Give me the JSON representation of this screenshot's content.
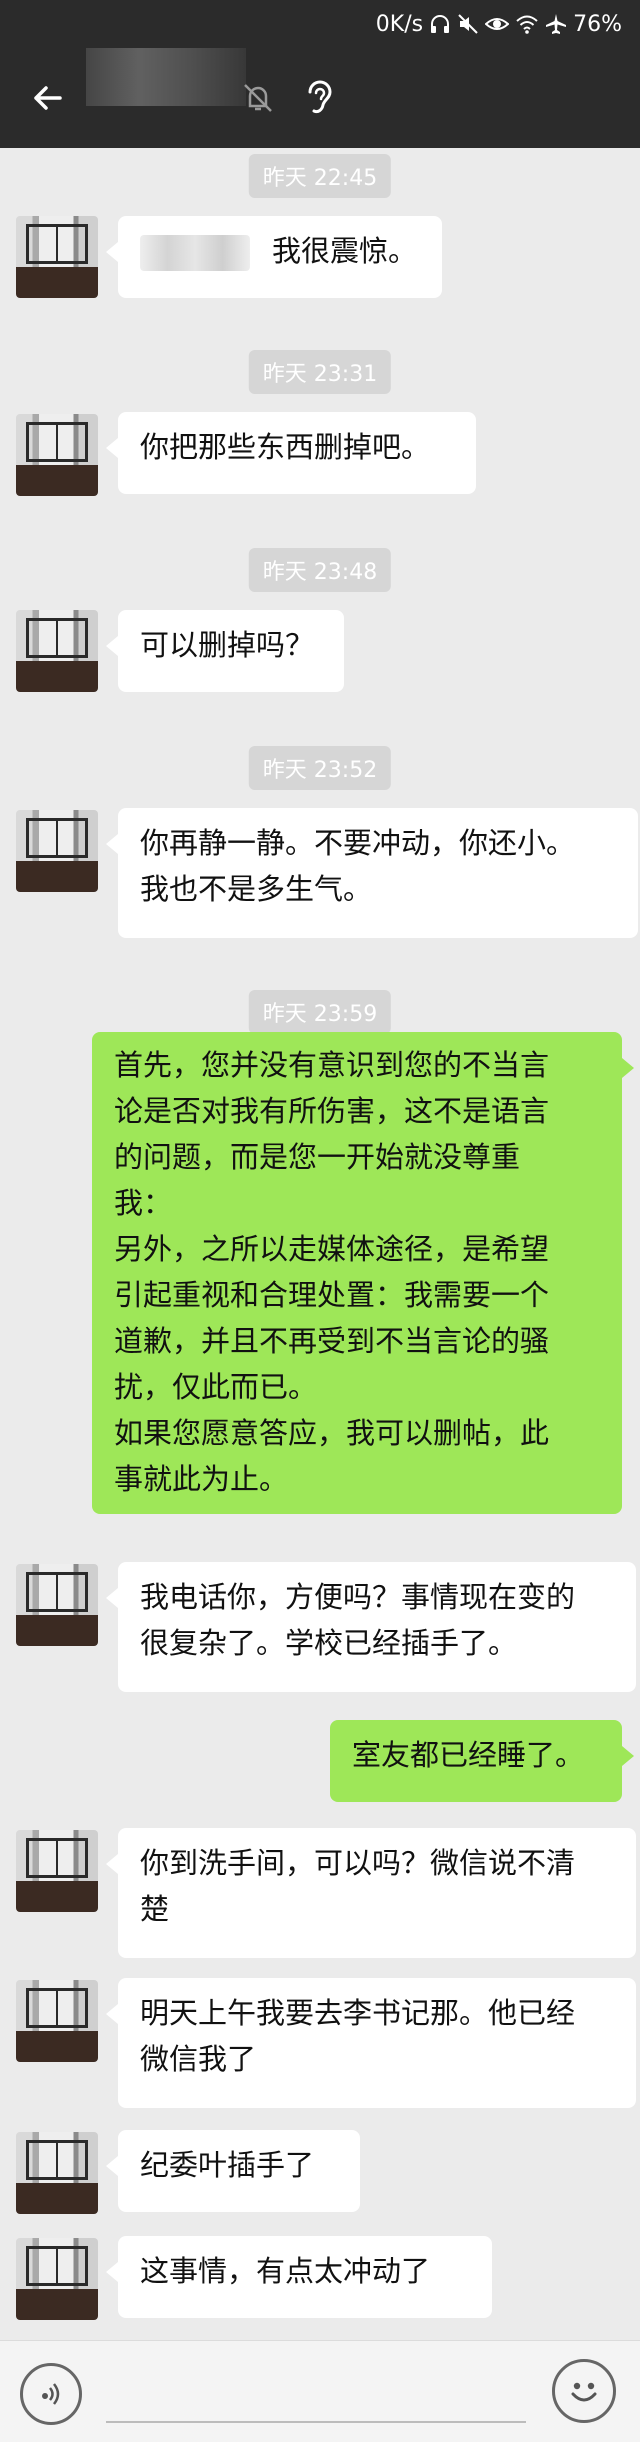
{
  "status_bar": {
    "speed": "0K/s",
    "battery": "76%",
    "icons": [
      "headphones-icon",
      "mute-icon",
      "eye-icon",
      "wifi-icon",
      "airplane-icon"
    ]
  },
  "header": {
    "icons": [
      "back-arrow-icon",
      "mute-notification-icon",
      "earpiece-icon"
    ]
  },
  "messages": [
    {
      "type": "time",
      "text": "昨天 22:45"
    },
    {
      "type": "in",
      "text": "我很震惊。"
    },
    {
      "type": "time",
      "text": "昨天 23:31"
    },
    {
      "type": "in",
      "text": "你把那些东西删掉吧。"
    },
    {
      "type": "time",
      "text": "昨天 23:48"
    },
    {
      "type": "in",
      "text": "可以删掉吗？"
    },
    {
      "type": "time",
      "text": "昨天 23:52"
    },
    {
      "type": "in",
      "lines": [
        "你再静一静。不要冲动，你还小。",
        "我也不是多生气。"
      ]
    },
    {
      "type": "time",
      "text": "昨天 23:59"
    },
    {
      "type": "out",
      "lines": [
        "首先，您并没有意识到您的不当言",
        "论是否对我有所伤害，这不是语言",
        "的问题，而是您一开始就没尊重",
        "我：",
        "另外，之所以走媒体途径，是希望",
        "引起重视和合理处置：我需要一个",
        "道歉，并且不再受到不当言论的骚",
        "扰，仅此而已。",
        "如果您愿意答应，我可以删帖，此",
        "事就此为止。"
      ]
    },
    {
      "type": "in",
      "lines": [
        "我电话你，方便吗？事情现在变的",
        "很复杂了。学校已经插手了。"
      ]
    },
    {
      "type": "out",
      "text": "室友都已经睡了。"
    },
    {
      "type": "in",
      "lines": [
        "你到洗手间，可以吗？微信说不清",
        "楚"
      ]
    },
    {
      "type": "in",
      "lines": [
        "明天上午我要去李书记那。他已经",
        "微信我了"
      ]
    },
    {
      "type": "in",
      "text": "纪委叶插手了"
    },
    {
      "type": "in",
      "text": "这事情，有点太冲动了"
    }
  ],
  "input_bar": {
    "icons": [
      "voice-icon",
      "emoji-icon"
    ]
  },
  "colors": {
    "title_bar": "#2b2b2b",
    "chat_background": "#ebebeb",
    "outgoing_bubble": "#9ee758",
    "incoming_bubble": "#ffffff",
    "timestamp_chip": "#d6d6d6"
  }
}
